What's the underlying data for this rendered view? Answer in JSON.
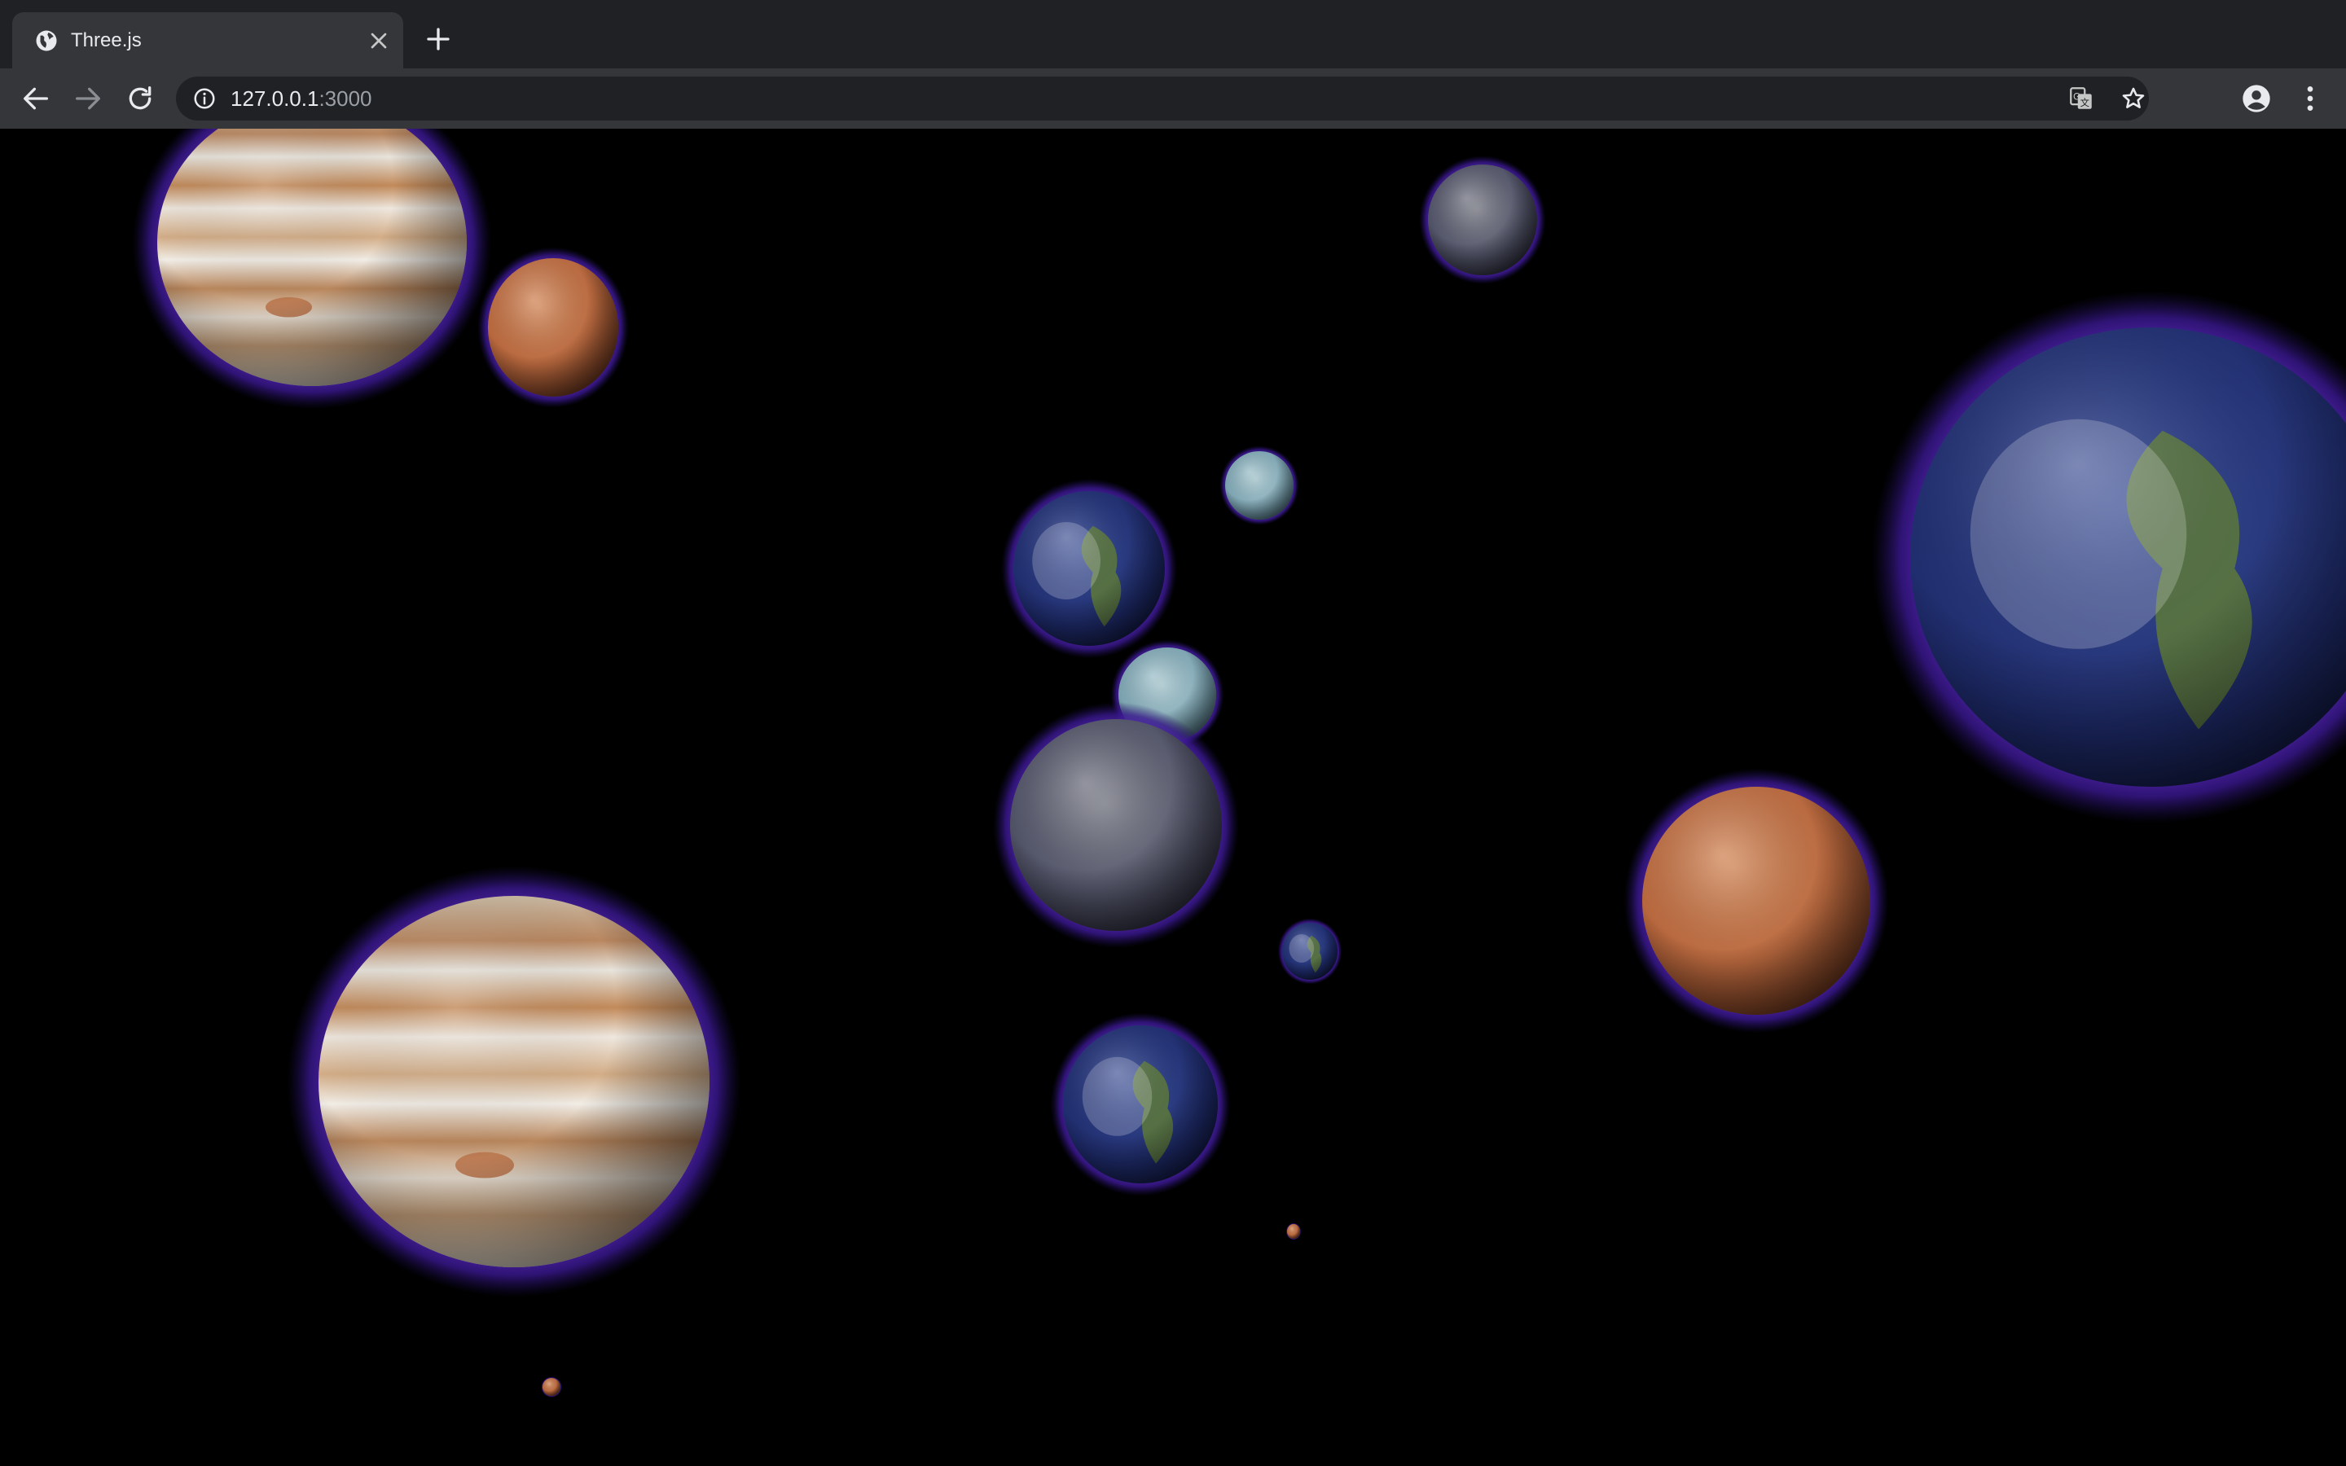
{
  "tab": {
    "title": "Three.js"
  },
  "address_bar": {
    "host": "127.0.0.1",
    "port": ":3000"
  },
  "icons": {
    "favicon": "globe-icon",
    "close": "close-icon",
    "new_tab": "plus-icon",
    "back": "arrow-left-icon",
    "forward": "arrow-right-icon",
    "reload": "reload-icon",
    "site_info": "info-icon",
    "translate": "translate-icon",
    "bookmark": "star-icon",
    "profile": "account-circle-icon",
    "menu": "more-vertical-icon"
  },
  "colors": {
    "tabstrip": "#202124",
    "toolbar": "#35363a",
    "omnibox": "#202124",
    "glow": "#4a1f9e",
    "background": "#000000"
  },
  "scene": {
    "planets": [
      {
        "name": "jupiter",
        "kind": "jupiter"
      },
      {
        "name": "mars",
        "kind": "mars"
      },
      {
        "name": "mercury",
        "kind": "mercury"
      },
      {
        "name": "earth",
        "kind": "earth"
      },
      {
        "name": "uranus",
        "kind": "ice"
      },
      {
        "name": "earth",
        "kind": "earth"
      },
      {
        "name": "uranus",
        "kind": "ice"
      },
      {
        "name": "mercury",
        "kind": "mercury"
      },
      {
        "name": "earth",
        "kind": "earth"
      },
      {
        "name": "mars",
        "kind": "mars"
      },
      {
        "name": "jupiter",
        "kind": "jupiter"
      },
      {
        "name": "earth",
        "kind": "earth"
      },
      {
        "name": "mars",
        "kind": "mars"
      },
      {
        "name": "mars",
        "kind": "mars"
      }
    ]
  }
}
